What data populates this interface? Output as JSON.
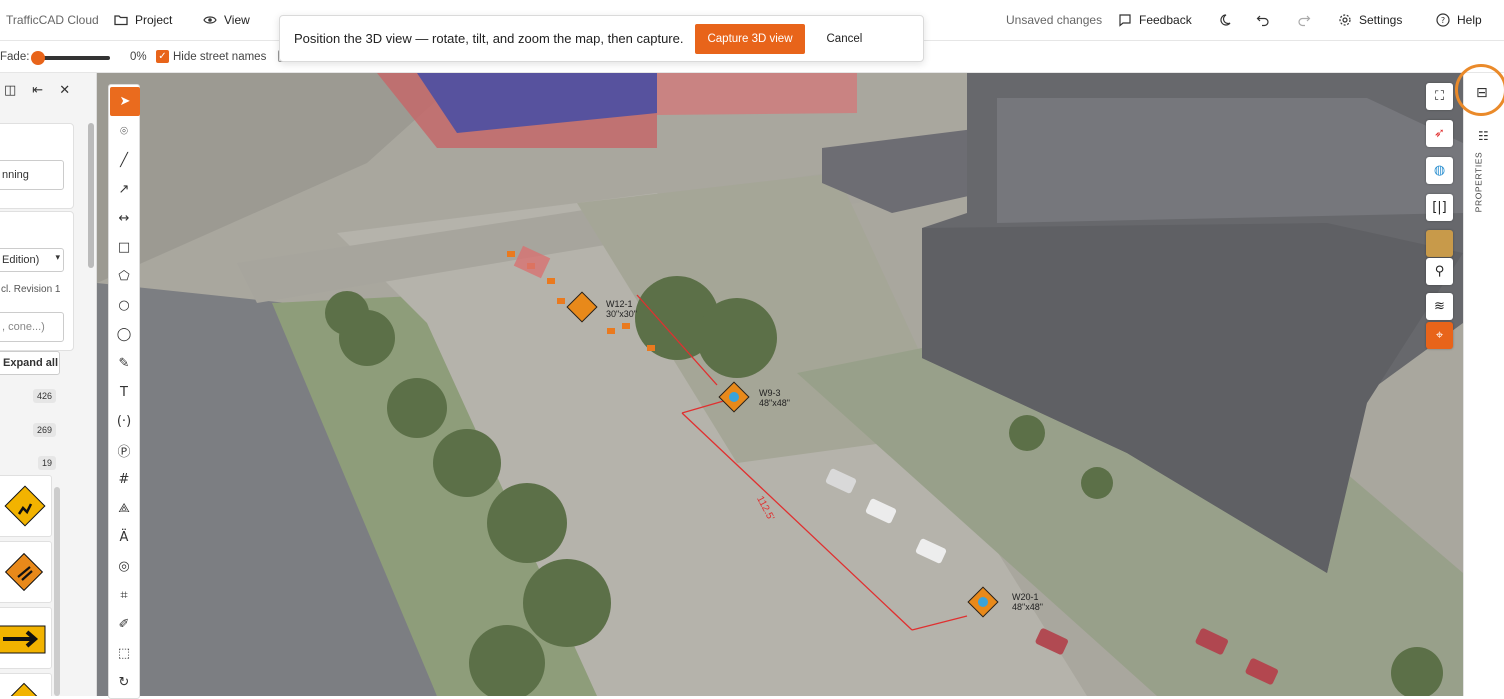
{
  "topbar": {
    "app_name": "TrafficCAD Cloud",
    "project_label": "Project",
    "view_label": "View",
    "unsaved_label": "Unsaved changes",
    "feedback_label": "Feedback",
    "settings_label": "Settings",
    "help_label": "Help"
  },
  "options": {
    "fade_label": "Fade:",
    "fade_value": "0%",
    "fade_fraction": 0,
    "hide_street_names_label": "Hide street names",
    "hide_street_names_checked": true
  },
  "banner": {
    "message": "Position the 3D view — rotate, tilt, and zoom the map, then capture.",
    "capture_label": "Capture 3D view",
    "cancel_label": "Cancel"
  },
  "left_panel": {
    "partial_button_label": "nning",
    "select_value": "Edition)",
    "revision_text": "cl. Revision 1",
    "search_placeholder": ", cone...)",
    "expand_all_label": "Expand all",
    "counts": [
      "426",
      "269",
      "19"
    ]
  },
  "map": {
    "signs": [
      {
        "code": "W12-1",
        "size": "30\"x30\""
      },
      {
        "code": "W9-3",
        "size": "48\"x48\""
      },
      {
        "code": "W20-1",
        "size": "48\"x48\""
      }
    ],
    "dimension_label": "112.5'"
  },
  "right_panel": {
    "properties_label": "PROPERTIES"
  },
  "colors": {
    "accent": "#e8641a",
    "dimension_line": "#e03030"
  }
}
